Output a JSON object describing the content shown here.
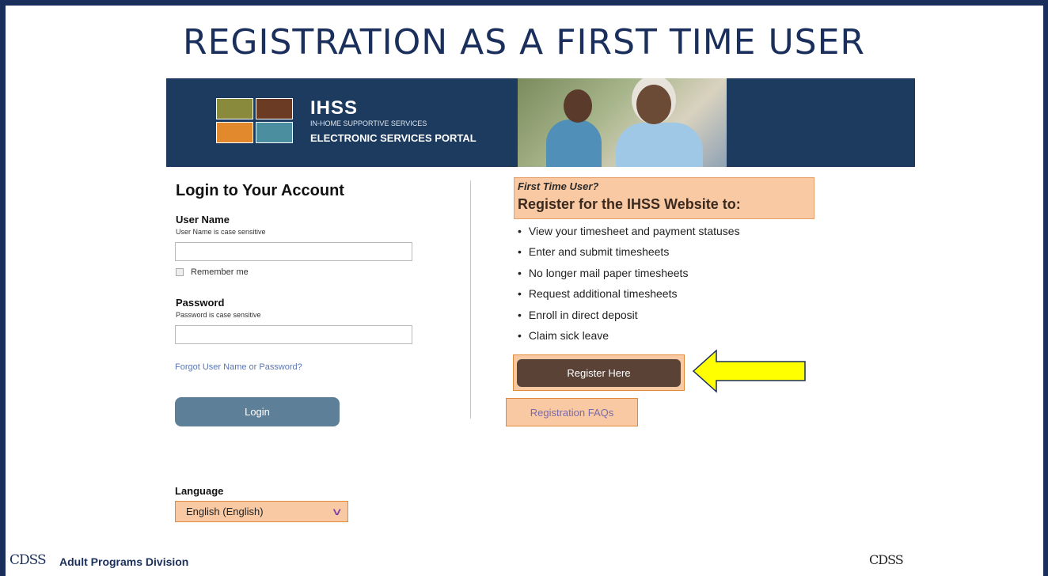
{
  "slide": {
    "title": "REGISTRATION AS A FIRST TIME USER",
    "frame_color": "#1b2f5c"
  },
  "portal_header": {
    "brand": "IHSS",
    "brand_subtitle": "IN-HOME SUPPORTIVE SERVICES",
    "portal_name": "ELECTRONIC SERVICES PORTAL",
    "logo_colors": [
      "#8a8a3c",
      "#6b3b24",
      "#e2892d",
      "#4a8ea0"
    ],
    "background_color": "#1d3b5f"
  },
  "login": {
    "title": "Login to Your Account",
    "username_label": "User Name",
    "username_hint": "User Name is case sensitive",
    "username_value": "",
    "remember_label": "Remember me",
    "remember_checked": false,
    "password_label": "Password",
    "password_hint": "Password is case sensitive",
    "password_value": "",
    "forgot_link": "Forgot User Name or Password?",
    "login_button": "Login"
  },
  "language": {
    "label": "Language",
    "selected": "English (English)"
  },
  "register": {
    "first_time_user": "First Time User?",
    "heading": "Register for the IHSS Website to:",
    "benefits": [
      "View your timesheet and payment statuses",
      "Enter and submit timesheets",
      "No longer mail paper timesheets",
      "Request additional timesheets",
      "Enroll in direct deposit",
      "Claim sick leave"
    ],
    "register_button": "Register Here",
    "faq_link": "Registration FAQs"
  },
  "footer": {
    "logo_left": "CDSS",
    "division": "Adult Programs Division",
    "logo_right": "CDSS"
  },
  "colors": {
    "highlight": "#f8c9a3",
    "arrow": "#ffff00",
    "register_button": "#5a4236",
    "login_button": "#5e7f98"
  },
  "icons": [
    "pointing-arrow-icon",
    "chevron-down-icon",
    "ihss-logo-icon"
  ]
}
